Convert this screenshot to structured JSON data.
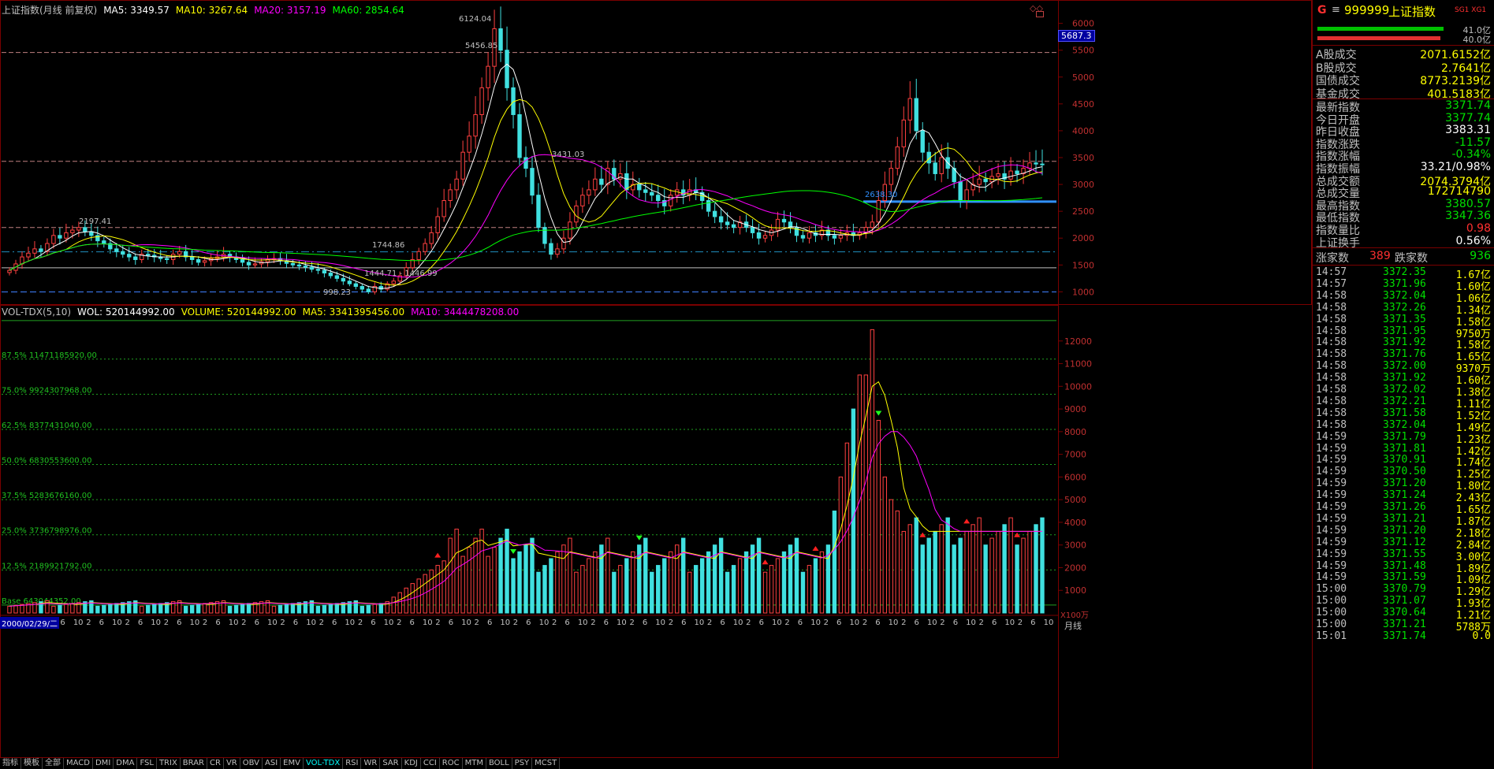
{
  "main_header": {
    "title": "上证指数(月线 前复权)",
    "ma5": "MA5: 3349.57",
    "ma10": "MA10: 3267.64",
    "ma20": "MA20: 3157.19",
    "ma60": "MA60: 2854.64"
  },
  "vol_header": {
    "title": "VOL-TDX(5,10)",
    "wol": "WOL: 520144992.00",
    "volume": "VOLUME: 520144992.00",
    "ma5": "MA5: 3341395456.00",
    "ma10": "MA10: 3444478208.00"
  },
  "price_axis": [
    "6000",
    "5500",
    "5000",
    "4500",
    "4000",
    "3500",
    "3000",
    "2500",
    "2000",
    "1500",
    "1000"
  ],
  "price_axis_badge": "5687.3",
  "vol_axis": [
    "12000",
    "11000",
    "10000",
    "9000",
    "8000",
    "7000",
    "6000",
    "5000",
    "4000",
    "3000",
    "2000",
    "1000"
  ],
  "vol_unit": "X100万",
  "annotations": {
    "peak": "6124.04",
    "high2": "5456.85",
    "high3": "3431.03",
    "high4": "2197.41",
    "low1": "1744.86",
    "low2": "1444.71 - 1446.99",
    "low3": "998.23",
    "mid": "2638.30"
  },
  "vol_levels": [
    "87.5% 11471185920.00",
    "75.0% 9924307968.00",
    "62.5% 8377431040.00",
    "50.0% 6830553600.00",
    "37.5% 5283676160.00",
    "25.0% 3736798976.00",
    "12.5% 2189921792.00",
    "Base 643044352.00"
  ],
  "x_axis_labels": [
    "2",
    "6",
    "10",
    "2",
    "6",
    "10",
    "2",
    "6",
    "10",
    "2",
    "6",
    "10",
    "2",
    "6",
    "10",
    "2",
    "6",
    "10",
    "2",
    "6",
    "10",
    "2",
    "6",
    "10",
    "2",
    "6",
    "10",
    "2",
    "6",
    "10",
    "2",
    "6",
    "10",
    "2",
    "6",
    "10",
    "2",
    "6",
    "10",
    "2",
    "6",
    "10",
    "2",
    "6",
    "10",
    "2",
    "6",
    "10",
    "2",
    "6",
    "10",
    "2",
    "6",
    "10",
    "2",
    "6",
    "10",
    "2",
    "6",
    "10",
    "2",
    "6",
    "10",
    "2",
    "6",
    "10",
    "2",
    "6",
    "10",
    "2",
    "6",
    "10",
    "2",
    "6",
    "10",
    "2",
    "6",
    "10"
  ],
  "date_badge": "2000/02/29/二",
  "period_label": "月线",
  "bottom_tabs": [
    "指标",
    "模板",
    "全部",
    "MACD",
    "DMI",
    "DMA",
    "FSL",
    "TRIX",
    "BRAR",
    "CR",
    "VR",
    "OBV",
    "ASI",
    "EMV",
    "VOL-TDX",
    "RSI",
    "WR",
    "SAR",
    "KDJ",
    "CCI",
    "ROC",
    "MTM",
    "BOLL",
    "PSY",
    "MCST"
  ],
  "right_panel": {
    "code": "999999",
    "name": "上证指数",
    "tag": "SG1 XG1",
    "g_label": "G",
    "bar1_value": "41.0亿",
    "bar2_value": "40.0亿",
    "turnover": [
      {
        "label": "A股成交",
        "value": "2071.6152亿"
      },
      {
        "label": "B股成交",
        "value": "2.7641亿"
      },
      {
        "label": "国债成交",
        "value": "8773.2139亿"
      },
      {
        "label": "基金成交",
        "value": "401.5183亿"
      }
    ],
    "stats": [
      {
        "label": "最新指数",
        "value": "3371.74",
        "color": "#00e000"
      },
      {
        "label": "今日开盘",
        "value": "3377.74",
        "color": "#00e000"
      },
      {
        "label": "昨日收盘",
        "value": "3383.31",
        "color": "#ffffff"
      },
      {
        "label": "指数涨跌",
        "value": "-11.57",
        "color": "#00e000"
      },
      {
        "label": "指数涨幅",
        "value": "-0.34%",
        "color": "#00e000"
      },
      {
        "label": "指数振幅",
        "value": "33.21/0.98%",
        "color": "#ffffff"
      },
      {
        "label": "总成交额",
        "value": "2074.3794亿",
        "color": "#ffff00"
      },
      {
        "label": "总成交量",
        "value": "172714790",
        "color": "#ffff00"
      },
      {
        "label": "最高指数",
        "value": "3380.57",
        "color": "#00e000"
      },
      {
        "label": "最低指数",
        "value": "3347.36",
        "color": "#00e000"
      },
      {
        "label": "指数量比",
        "value": "0.98",
        "color": "#ff3030"
      },
      {
        "label": "上证换手",
        "value": "0.56%",
        "color": "#ffffff"
      }
    ],
    "updown": {
      "up_label": "涨家数",
      "up_value": "389",
      "down_label": "跌家数",
      "down_value": "936"
    },
    "ticks": [
      {
        "t": "14:57",
        "p": "3372.35",
        "v": "1.67亿"
      },
      {
        "t": "14:57",
        "p": "3371.96",
        "v": "1.60亿"
      },
      {
        "t": "14:58",
        "p": "3372.04",
        "v": "1.06亿"
      },
      {
        "t": "14:58",
        "p": "3372.26",
        "v": "1.34亿"
      },
      {
        "t": "14:58",
        "p": "3371.35",
        "v": "1.58亿"
      },
      {
        "t": "14:58",
        "p": "3371.95",
        "v": "9750万"
      },
      {
        "t": "14:58",
        "p": "3371.92",
        "v": "1.58亿"
      },
      {
        "t": "14:58",
        "p": "3371.76",
        "v": "1.65亿"
      },
      {
        "t": "14:58",
        "p": "3372.00",
        "v": "9370万"
      },
      {
        "t": "14:58",
        "p": "3371.92",
        "v": "1.60亿"
      },
      {
        "t": "14:58",
        "p": "3372.02",
        "v": "1.38亿"
      },
      {
        "t": "14:58",
        "p": "3372.21",
        "v": "1.11亿"
      },
      {
        "t": "14:58",
        "p": "3371.58",
        "v": "1.52亿"
      },
      {
        "t": "14:58",
        "p": "3372.04",
        "v": "1.49亿"
      },
      {
        "t": "14:59",
        "p": "3371.79",
        "v": "1.23亿"
      },
      {
        "t": "14:59",
        "p": "3371.81",
        "v": "1.42亿"
      },
      {
        "t": "14:59",
        "p": "3370.91",
        "v": "1.74亿"
      },
      {
        "t": "14:59",
        "p": "3370.50",
        "v": "1.25亿"
      },
      {
        "t": "14:59",
        "p": "3371.20",
        "v": "1.80亿"
      },
      {
        "t": "14:59",
        "p": "3371.24",
        "v": "2.43亿"
      },
      {
        "t": "14:59",
        "p": "3371.26",
        "v": "1.65亿"
      },
      {
        "t": "14:59",
        "p": "3371.21",
        "v": "1.87亿"
      },
      {
        "t": "14:59",
        "p": "3371.20",
        "v": "2.18亿"
      },
      {
        "t": "14:59",
        "p": "3371.12",
        "v": "2.84亿"
      },
      {
        "t": "14:59",
        "p": "3371.55",
        "v": "3.00亿"
      },
      {
        "t": "14:59",
        "p": "3371.48",
        "v": "1.89亿"
      },
      {
        "t": "14:59",
        "p": "3371.59",
        "v": "1.09亿"
      },
      {
        "t": "15:00",
        "p": "3370.79",
        "v": "1.29亿"
      },
      {
        "t": "15:00",
        "p": "3371.07",
        "v": "1.93亿"
      },
      {
        "t": "15:00",
        "p": "3370.64",
        "v": "1.21亿"
      },
      {
        "t": "15:00",
        "p": "3371.21",
        "v": "5788万"
      },
      {
        "t": "15:01",
        "p": "3371.74",
        "v": "0.0"
      }
    ]
  },
  "chart_data": [
    {
      "type": "candlestick",
      "title": "上证指数(月线 前复权)",
      "series_names": [
        "MA5",
        "MA10",
        "MA20",
        "MA60"
      ],
      "ylim": [
        800,
        6200
      ],
      "close": [
        1400,
        1520,
        1650,
        1720,
        1800,
        1750,
        1900,
        2050,
        2000,
        2100,
        2150,
        2197,
        2120,
        2050,
        1950,
        1900,
        1800,
        1750,
        1700,
        1650,
        1600,
        1700,
        1680,
        1650,
        1620,
        1600,
        1700,
        1750,
        1650,
        1600,
        1550,
        1580,
        1620,
        1650,
        1700,
        1650,
        1600,
        1550,
        1500,
        1520,
        1560,
        1600,
        1620,
        1580,
        1530,
        1500,
        1480,
        1460,
        1420,
        1400,
        1350,
        1300,
        1250,
        1200,
        1150,
        1100,
        1050,
        1000,
        1100,
        1050,
        1150,
        1200,
        1300,
        1450,
        1600,
        1750,
        1900,
        2100,
        2400,
        2700,
        2900,
        3100,
        3600,
        3900,
        4300,
        4800,
        5200,
        5900,
        5500,
        4800,
        4300,
        3500,
        3300,
        2800,
        2200,
        1900,
        1700,
        1800,
        2000,
        2300,
        2600,
        2800,
        2900,
        3100,
        3000,
        3300,
        3100,
        3200,
        2900,
        3000,
        2900,
        2850,
        2800,
        2700,
        2600,
        2800,
        2900,
        2800,
        2900,
        2850,
        2700,
        2500,
        2400,
        2300,
        2250,
        2200,
        2300,
        2200,
        2100,
        2000,
        2050,
        2150,
        2350,
        2300,
        2200,
        2050,
        2000,
        2100,
        2050,
        2150,
        2050,
        2000,
        2050,
        2100,
        2050,
        2100,
        2200,
        2300,
        2700,
        3000,
        3300,
        3700,
        4200,
        4600,
        4000,
        3600,
        3400,
        3200,
        3500,
        3300,
        3050,
        2700,
        2900,
        3000,
        3100,
        3050,
        3150,
        3200,
        3100,
        3250,
        3200,
        3300,
        3400,
        3380,
        3372
      ]
    },
    {
      "type": "bar",
      "title": "VOL-TDX(5,10)",
      "ylim": [
        0,
        13000
      ]
    }
  ]
}
